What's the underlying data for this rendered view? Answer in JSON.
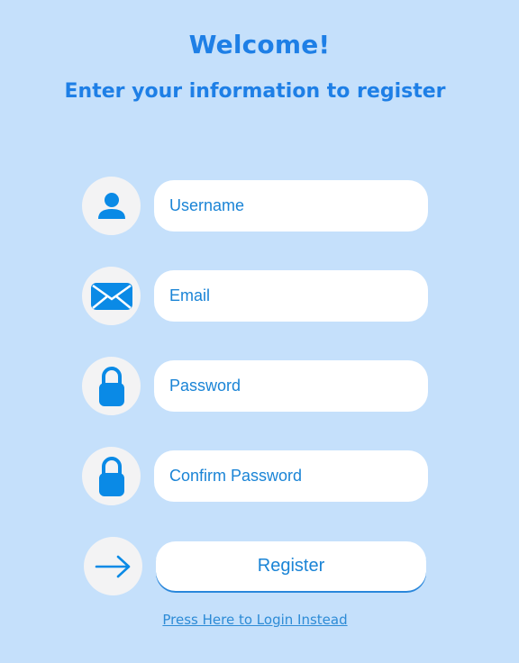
{
  "header": {
    "title": "Welcome!",
    "subtitle": "Enter your information to register"
  },
  "form": {
    "username": {
      "placeholder": "Username",
      "value": "",
      "icon": "user-icon"
    },
    "email": {
      "placeholder": "Email",
      "value": "",
      "icon": "envelope-icon"
    },
    "password": {
      "placeholder": "Password",
      "value": "",
      "icon": "lock-icon"
    },
    "confirm_password": {
      "placeholder": "Confirm Password",
      "value": "",
      "icon": "lock-icon"
    },
    "register_label": "Register",
    "register_icon": "arrow-right-icon",
    "login_link": "Press Here to Login Instead"
  },
  "colors": {
    "background": "#c5e0fb",
    "accent": "#1e7fe6",
    "icon": "#0a8ae6",
    "field_text": "#1a84d6",
    "icon_circle": "#f3f3f4"
  }
}
